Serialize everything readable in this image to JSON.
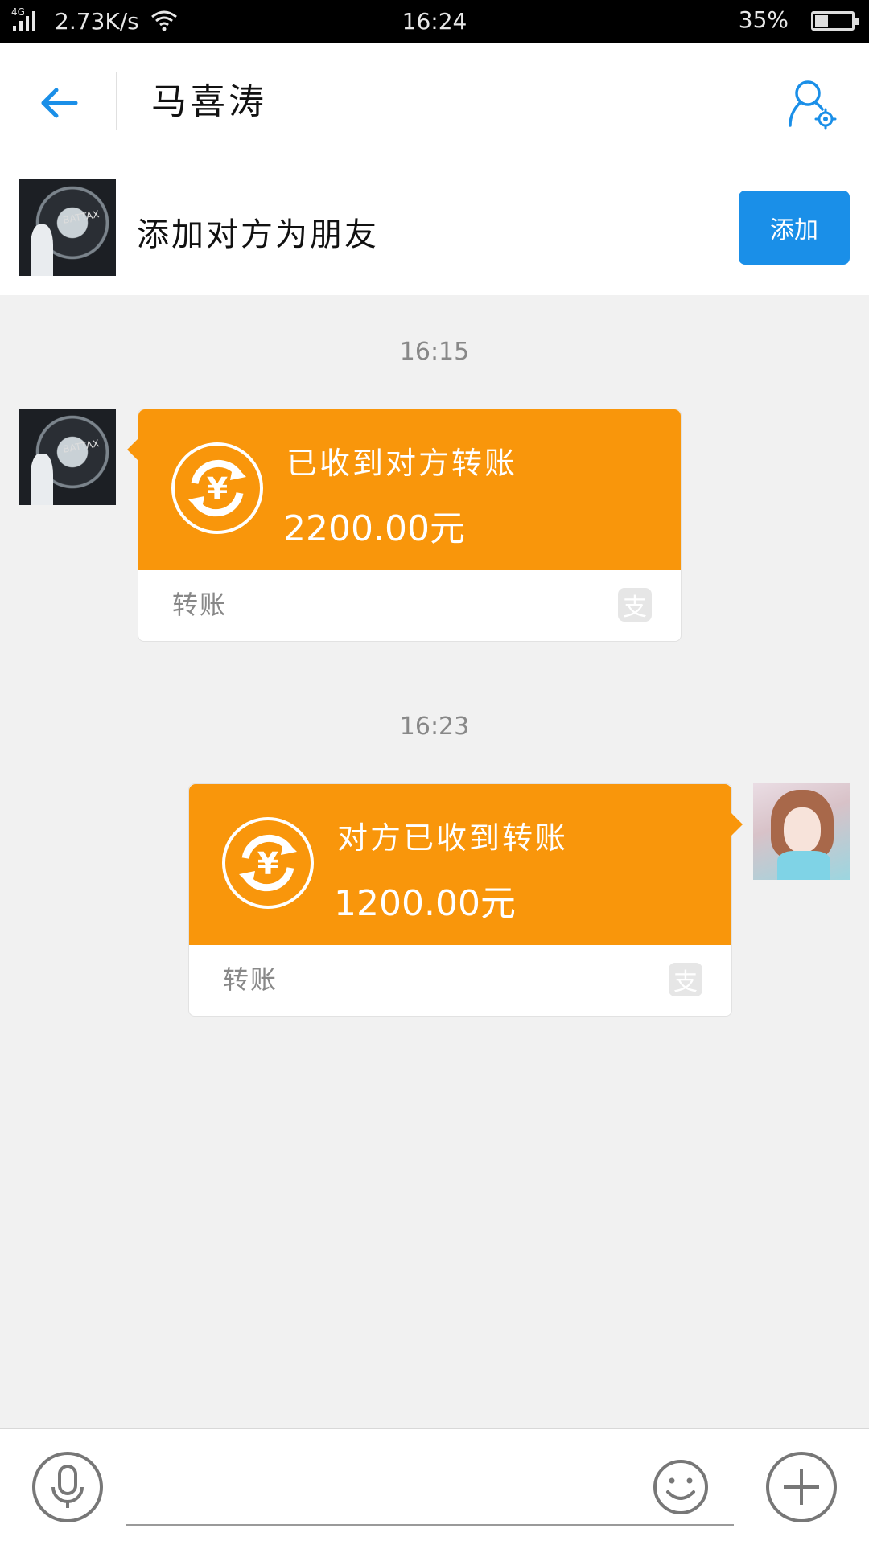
{
  "status_bar": {
    "network_type": "4G",
    "speed": "2.73K/s",
    "time": "16:24",
    "battery": "35%"
  },
  "header": {
    "title": "马喜涛"
  },
  "add_friend": {
    "label": "添加对方为朋友",
    "button_label": "添加",
    "avatar_text": "BATTAX"
  },
  "messages": [
    {
      "timestamp": "16:15",
      "side": "left",
      "status": "已收到对方转账",
      "amount": "2200.00元",
      "kind": "转账",
      "badge": "支"
    },
    {
      "timestamp": "16:23",
      "side": "right",
      "status": "对方已收到转账",
      "amount": "1200.00元",
      "kind": "转账",
      "badge": "支"
    }
  ],
  "colors": {
    "accent": "#1a8fe8",
    "transfer_orange": "#f9960b",
    "background": "#f1f1f1"
  },
  "icons": [
    "back-arrow-icon",
    "profile-settings-icon",
    "transfer-yuan-icon",
    "alipay-icon",
    "microphone-icon",
    "emoji-icon",
    "plus-icon"
  ]
}
